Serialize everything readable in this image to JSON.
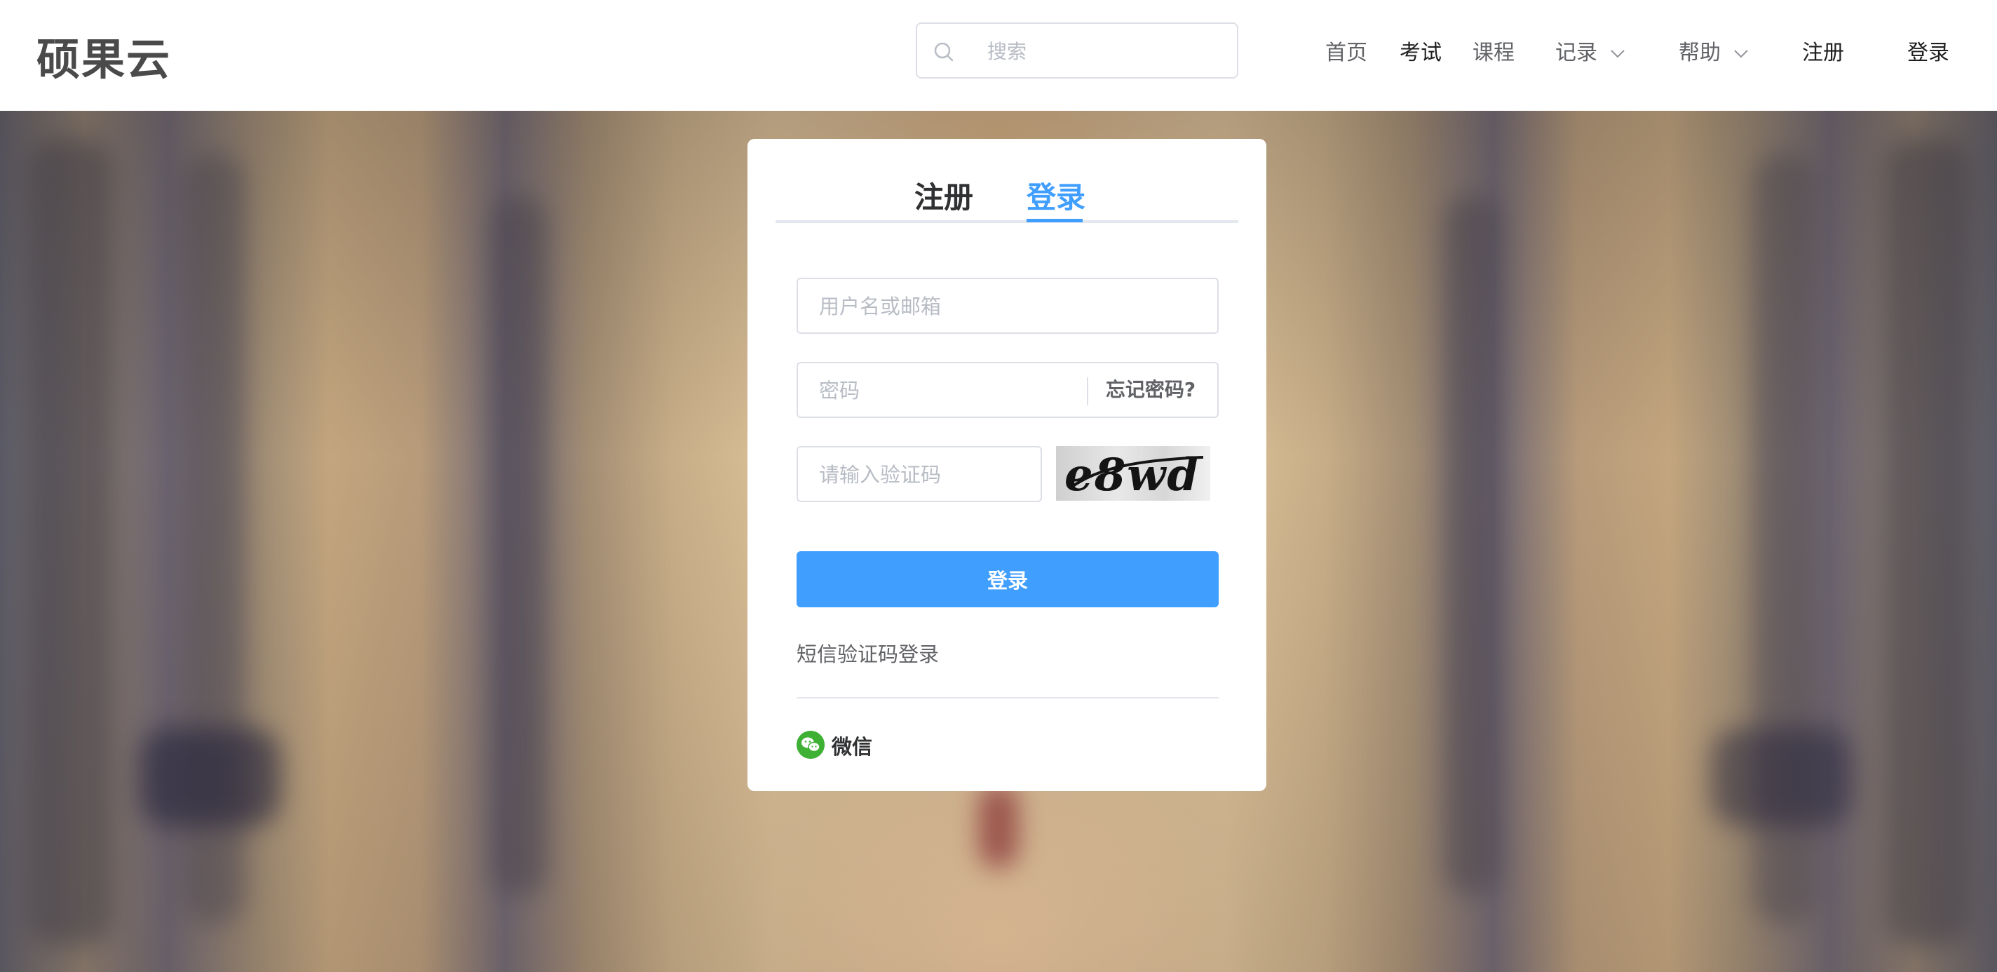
{
  "header": {
    "logo": "硕果云",
    "search": {
      "placeholder": "搜索",
      "icon": "search-icon"
    },
    "nav": {
      "home": "首页",
      "exam": "考试",
      "course": "课程",
      "records": "记录",
      "help": "帮助",
      "register": "注册",
      "login": "登录"
    }
  },
  "login_card": {
    "tabs": {
      "register": "注册",
      "login": "登录",
      "active": "login"
    },
    "username": {
      "placeholder": "用户名或邮箱",
      "value": ""
    },
    "password": {
      "placeholder": "密码",
      "value": "",
      "forgot": "忘记密码?"
    },
    "captcha": {
      "placeholder": "请输入验证码",
      "value": "",
      "image_text": "e8wd"
    },
    "submit": "登录",
    "sms_login": "短信验证码登录",
    "wechat": {
      "label": "微信",
      "icon": "wechat-icon"
    }
  },
  "colors": {
    "accent": "#409eff",
    "wechat": "#3eb135",
    "text": "#303133",
    "muted": "#606266",
    "border": "#dcdfe6"
  }
}
